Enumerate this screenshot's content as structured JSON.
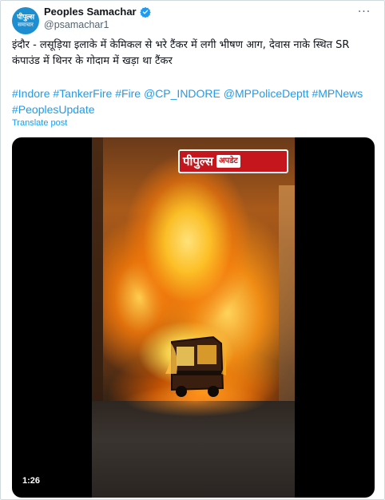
{
  "account": {
    "avatar_line1": "पीपुल्स",
    "avatar_line2": "समाचार",
    "display_name": "Peoples Samachar",
    "handle": "@psamachar1",
    "verified": true
  },
  "more_menu_glyph": "···",
  "tweet": {
    "text": "इंदौर - लसूड़िया इलाके में केमिकल से भरे टैंकर में लगी भीषण आग, देवास नाके स्थित SR कंपाउंड में थिनर के गोदाम में खड़ा था टैंकर",
    "hashtags": [
      "#Indore",
      "#TankerFire",
      "#Fire",
      "@CP_INDORE",
      "@MPPoliceDeptt",
      "#MPNews",
      "#PeoplesUpdate"
    ],
    "translate_label": "Translate post"
  },
  "video": {
    "logo_main": "पीपुल्स",
    "logo_sub": "अपडेट",
    "duration": "1:26"
  },
  "colors": {
    "link": "#1d9bf0",
    "handle": "#536471",
    "brand_red": "#c4161c",
    "avatar_blue": "#1d8fd0"
  },
  "icons": {
    "verified": "verified-badge-icon",
    "more": "more-dots-icon"
  }
}
